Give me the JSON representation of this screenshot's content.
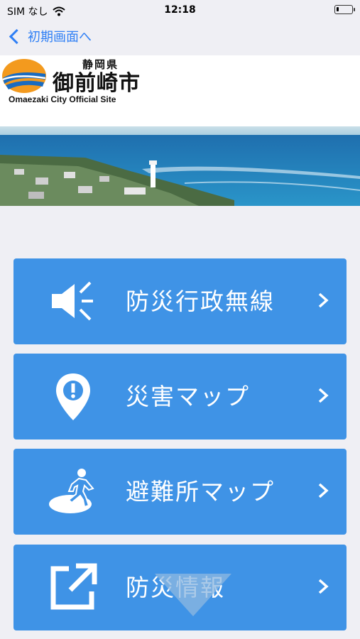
{
  "status_bar": {
    "carrier": "SIM なし",
    "time": "12:18",
    "battery_level": 0.15
  },
  "nav": {
    "back_label": "初期画面へ"
  },
  "header": {
    "prefecture": "静岡県",
    "city": "御前崎市",
    "english_name": "Omaezaki City Official Site"
  },
  "menu": [
    {
      "label": "防災行政無線",
      "icon": "speaker-icon"
    },
    {
      "label": "災害マップ",
      "icon": "map-pin-icon"
    },
    {
      "label": "避難所マップ",
      "icon": "evacuation-icon"
    },
    {
      "label": "防災情報",
      "icon": "external-link-icon"
    }
  ],
  "colors": {
    "accent": "#2f7ff5",
    "button": "#3f93e6",
    "background": "#efeff4"
  }
}
